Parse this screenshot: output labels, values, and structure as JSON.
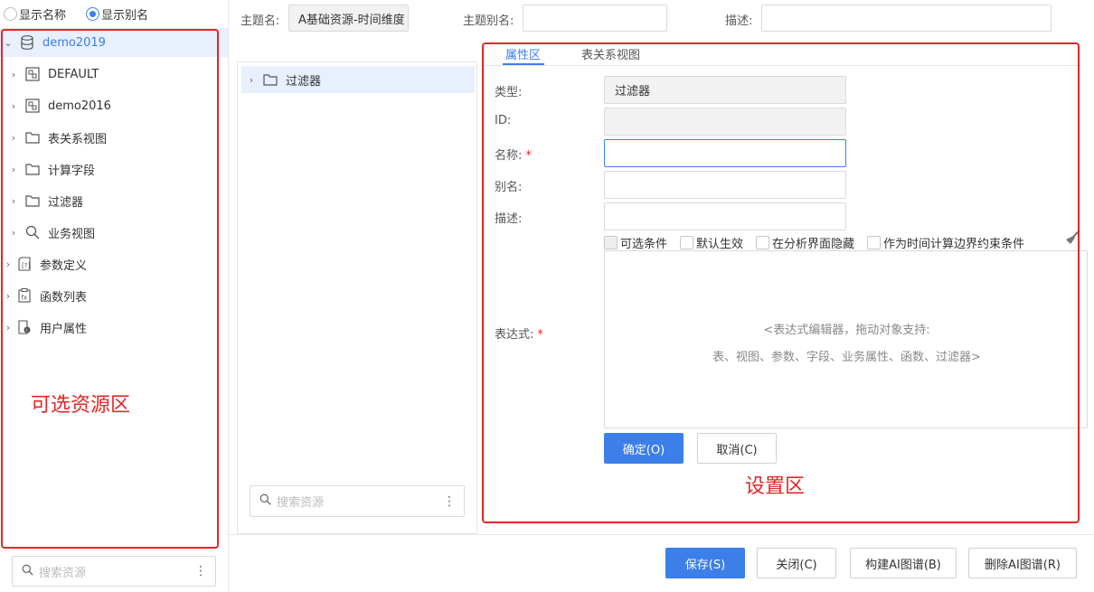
{
  "left": {
    "radio_name": "显示名称",
    "radio_alias": "显示别名",
    "tree": {
      "root": "demo2019",
      "children": [
        "DEFAULT",
        "demo2016",
        "表关系视图",
        "计算字段",
        "过滤器",
        "业务视图"
      ],
      "siblings": [
        "参数定义",
        "函数列表",
        "用户属性"
      ]
    },
    "search_placeholder": "搜索资源",
    "annotation": "可选资源区"
  },
  "header": {
    "subject_name_label": "主题名:",
    "subject_name_value": "A基础资源-时间维度",
    "subject_alias_label": "主题别名:",
    "desc_label": "描述:"
  },
  "middle": {
    "node": "过滤器",
    "search_placeholder": "搜索资源"
  },
  "tabs": [
    "属性区",
    "表关系视图"
  ],
  "form": {
    "type_label": "类型:",
    "type_value": "过滤器",
    "id_label": "ID:",
    "name_label": "名称:",
    "alias_label": "别名:",
    "desc_label": "描述:",
    "expr_label": "表达式:",
    "required_mark": "*",
    "checkboxes": [
      "可选条件",
      "默认生效",
      "在分析界面隐藏",
      "作为时间计算边界约束条件"
    ],
    "hint_line1": "<表达式编辑器，拖动对象支持:",
    "hint_line2": "表、视图、参数、字段、业务属性、函数、过滤器>",
    "ok": "确定(O)",
    "cancel": "取消(C)",
    "annotation": "设置区"
  },
  "footer": {
    "save": "保存(S)",
    "close": "关闭(C)",
    "build_ai": "构建AI图谱(B)",
    "delete_ai": "删除AI图谱(R)"
  },
  "colors": {
    "accent": "#3c7fe8",
    "annotation_red": "#e32626",
    "selected_bg": "#e8effd"
  }
}
